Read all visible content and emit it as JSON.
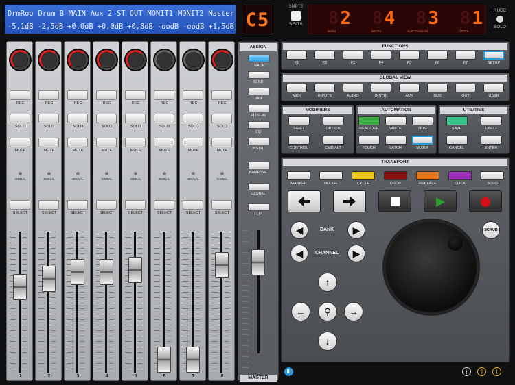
{
  "lcd": {
    "names": [
      "DrmRoo",
      "Drum B",
      "MAIN",
      "Aux 2",
      "ST OUT",
      "MONIT1",
      "MONIT2",
      "Master"
    ],
    "values": [
      "-5,1dB",
      "-2,5dB",
      "+0,0dB",
      "+0,0dB",
      "+0,8dB",
      "-oodB",
      "-oodB",
      "+1,5dB"
    ]
  },
  "assign_display": "C5",
  "smpte": {
    "top": "SMPTE",
    "bottom": "BEATS"
  },
  "timecode": {
    "digits": [
      "2",
      "4",
      "3",
      "1"
    ],
    "ghosts": [
      "8",
      "8",
      "8",
      "8"
    ],
    "labels": [
      "BARS",
      "BEATS",
      "SUB DIVISION",
      "TICKS"
    ]
  },
  "rude_solo": {
    "line1": "RUDE",
    "line2": "SOLO"
  },
  "strip": {
    "rec": "REC",
    "solo": "SOLO",
    "mute": "MUTE",
    "signal": "SIGNAL",
    "select": "SELECT",
    "scale": [
      "10",
      "5",
      "0",
      "5",
      "10",
      "15",
      "20",
      "30",
      "40",
      "50",
      "60"
    ],
    "channels": [
      {
        "num": "1",
        "fader": 0.63,
        "knob": "red"
      },
      {
        "num": "2",
        "fader": 0.7,
        "knob": "red"
      },
      {
        "num": "3",
        "fader": 0.76,
        "knob": "red"
      },
      {
        "num": "4",
        "fader": 0.76,
        "knob": "red"
      },
      {
        "num": "5",
        "fader": 0.78,
        "knob": "red"
      },
      {
        "num": "6",
        "fader": 0.0,
        "knob": "grey"
      },
      {
        "num": "7",
        "fader": 0.0,
        "knob": "grey"
      },
      {
        "num": "8",
        "fader": 0.82,
        "knob": "red"
      }
    ]
  },
  "assign": {
    "title": "ASSIGN",
    "buttons": [
      "TRACK",
      "SEND",
      "PAN",
      "PLUG-IN",
      "EQ",
      "INSTR."
    ],
    "extra": [
      "NAME/VAL",
      "GLOBAL",
      "FLIP"
    ],
    "master_label": "MASTER",
    "master_fader": 0.8
  },
  "functions": {
    "title": "FUNCTIONS",
    "buttons": [
      "F1",
      "F2",
      "F3",
      "F4",
      "F5",
      "F6",
      "F7",
      "SETUP"
    ]
  },
  "global_view": {
    "title": "GLOBAL VIEW",
    "buttons": [
      "MIDI",
      "INPUTS",
      "AUDIO",
      "INSTR.",
      "AUX",
      "BUS",
      "OUT",
      "USER"
    ]
  },
  "modifiers": {
    "title": "MODIFIERS",
    "buttons": [
      "SHIFT",
      "OPTION",
      "CONTROL",
      "CMD/ALT"
    ]
  },
  "automation": {
    "title": "AUTOMATION",
    "buttons": [
      "READ/OFF",
      "WRITE",
      "TRIM",
      "TOUCH",
      "LATCH",
      "MIXER"
    ]
  },
  "utilities": {
    "title": "UTILITIES",
    "buttons": [
      "SAVE",
      "UNDO",
      "CANCEL",
      "ENTER"
    ]
  },
  "transport": {
    "title": "TRANSPORT",
    "buttons": [
      "MARKER",
      "NUDGE",
      "CYCLE",
      "DROP",
      "REPLACE",
      "CLICK",
      "SOLO"
    ],
    "bank": "BANK",
    "channel": "CHANNEL",
    "scrub": "SCRUB"
  },
  "colors": {
    "accent_blue": "#2a9bdc",
    "automation_read": "#3cb043",
    "cycle_yellow": "#e9c80c",
    "drop_red": "#8b0f12",
    "replace_orange": "#e67417",
    "click_purple": "#9a2fb8",
    "save_green": "#38c48a",
    "record_red": "#d40f18",
    "play_green": "#2f9e2f"
  }
}
